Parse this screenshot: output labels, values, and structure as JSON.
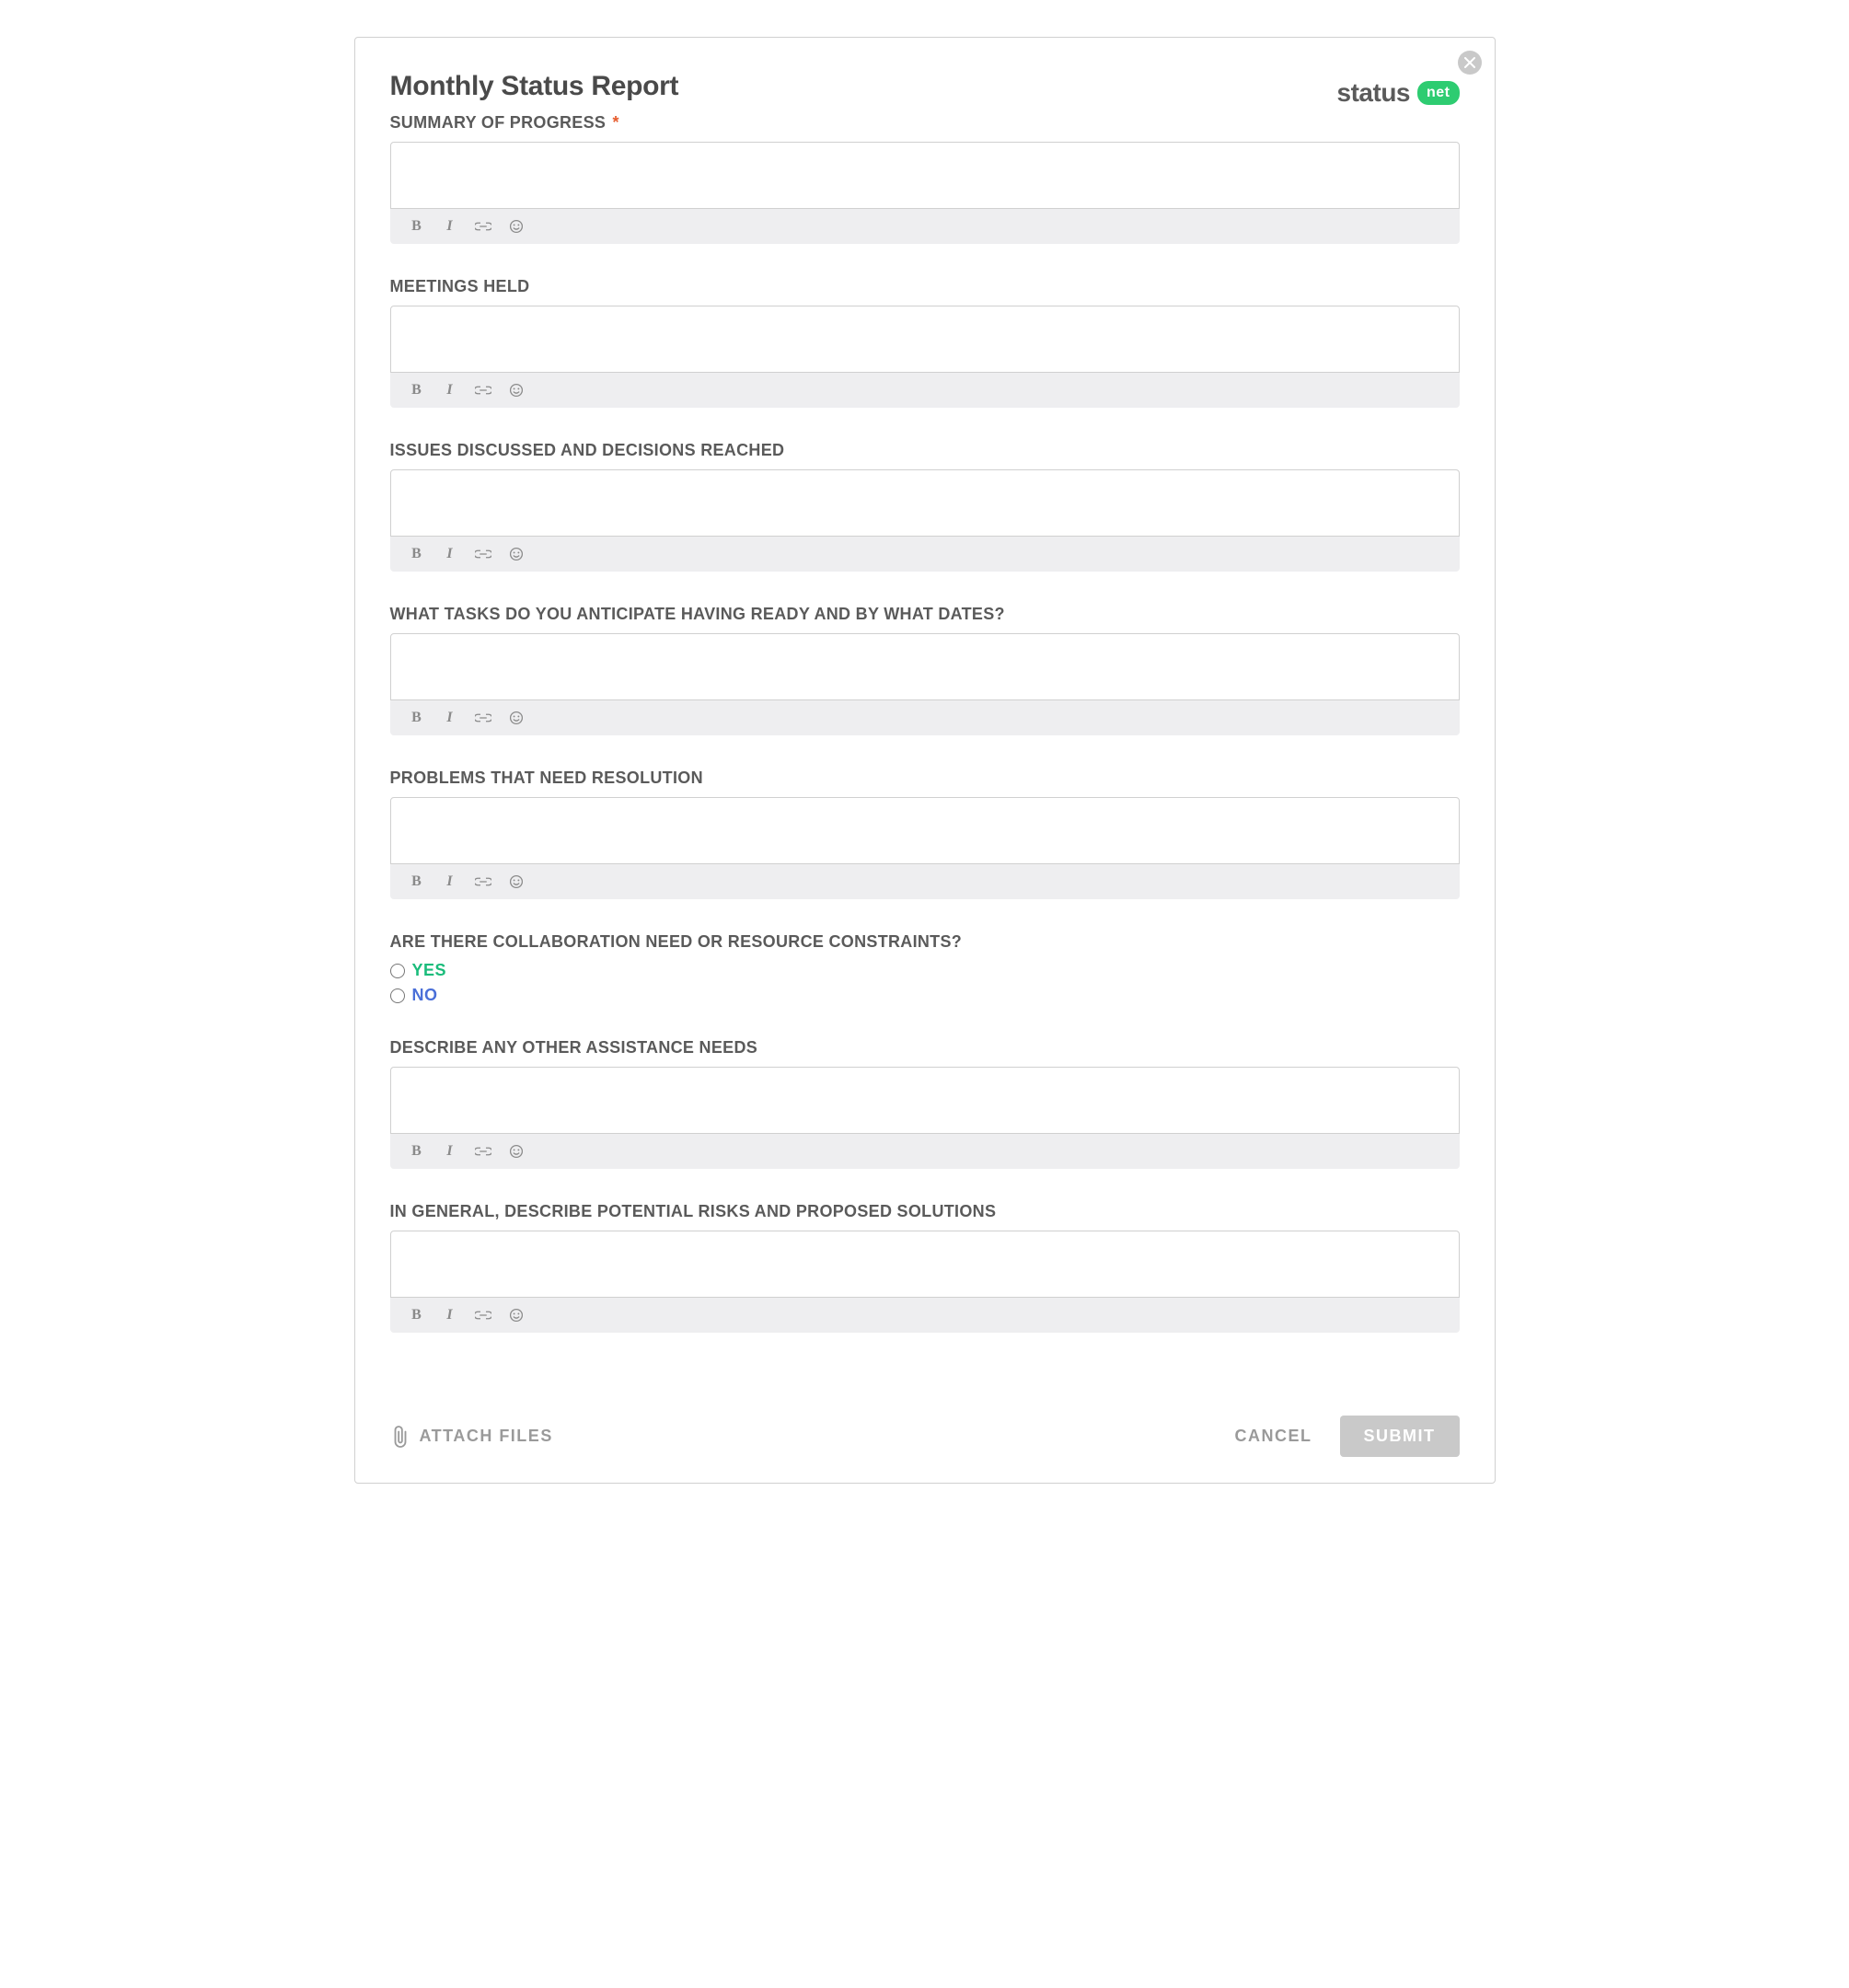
{
  "title": "Monthly Status Report",
  "logo": {
    "text": "status",
    "badge": "net"
  },
  "required_mark": "*",
  "sections": {
    "summary": {
      "label": "SUMMARY OF PROGRESS",
      "required": true,
      "value": ""
    },
    "meetings": {
      "label": "MEETINGS HELD",
      "required": false,
      "value": ""
    },
    "issues": {
      "label": "ISSUES DISCUSSED AND DECISIONS REACHED",
      "required": false,
      "value": ""
    },
    "tasks": {
      "label": "WHAT TASKS DO YOU ANTICIPATE HAVING READY AND BY WHAT DATES?",
      "required": false,
      "value": ""
    },
    "problems": {
      "label": "PROBLEMS THAT NEED RESOLUTION",
      "required": false,
      "value": ""
    },
    "collab": {
      "label": "ARE THERE COLLABORATION NEED OR RESOURCE CONSTRAINTS?",
      "options": {
        "yes": "YES",
        "no": "NO"
      }
    },
    "assistance": {
      "label": "DESCRIBE ANY OTHER ASSISTANCE NEEDS",
      "required": false,
      "value": ""
    },
    "risks": {
      "label": "IN GENERAL, DESCRIBE POTENTIAL RISKS AND PROPOSED SOLUTIONS",
      "required": false,
      "value": ""
    }
  },
  "toolbar": {
    "bold": "B",
    "italic": "I"
  },
  "footer": {
    "attach": "ATTACH FILES",
    "cancel": "CANCEL",
    "submit": "SUBMIT"
  }
}
